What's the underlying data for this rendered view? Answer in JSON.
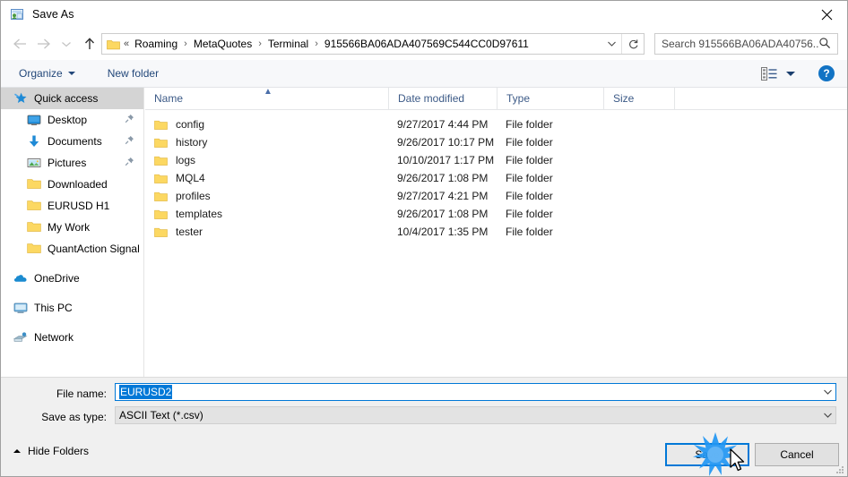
{
  "window": {
    "title": "Save As",
    "icon": "save-as-icon",
    "close_label": "✕"
  },
  "nav": {
    "back_icon": "arrow-left-icon",
    "forward_icon": "arrow-right-icon",
    "recent_icon": "chevron-down-icon",
    "up_icon": "arrow-up-icon",
    "address": {
      "folder_icon": "folder-icon",
      "prefix": "«",
      "crumbs": [
        "Roaming",
        "MetaQuotes",
        "Terminal",
        "915566BA06ADA407569C544CC0D97611"
      ],
      "separator": "›",
      "dropdown_icon": "chevron-down-icon",
      "refresh_icon": "refresh-icon"
    },
    "search": {
      "placeholder": "Search 915566BA06ADA40756...",
      "icon": "search-icon"
    }
  },
  "toolbar": {
    "organize_label": "Organize",
    "new_folder_label": "New folder",
    "view_icon": "view-layout-icon",
    "help_label": "?"
  },
  "sidebar": {
    "items": [
      {
        "label": "Quick access",
        "icon": "quick-access-star-icon",
        "level": 0,
        "selected": true,
        "pinned": false
      },
      {
        "label": "Desktop",
        "icon": "desktop-icon",
        "level": 1,
        "selected": false,
        "pinned": true
      },
      {
        "label": "Documents",
        "icon": "documents-download-icon",
        "level": 1,
        "selected": false,
        "pinned": true
      },
      {
        "label": "Pictures",
        "icon": "pictures-icon",
        "level": 1,
        "selected": false,
        "pinned": true
      },
      {
        "label": "Downloaded",
        "icon": "folder-icon",
        "level": 1,
        "selected": false,
        "pinned": false
      },
      {
        "label": "EURUSD H1",
        "icon": "folder-icon",
        "level": 1,
        "selected": false,
        "pinned": false
      },
      {
        "label": "My Work",
        "icon": "folder-icon",
        "level": 1,
        "selected": false,
        "pinned": false
      },
      {
        "label": "QuantAction Signal",
        "icon": "folder-icon",
        "level": 1,
        "selected": false,
        "pinned": false
      }
    ],
    "groups": [
      {
        "label": "OneDrive",
        "icon": "onedrive-cloud-icon"
      },
      {
        "label": "This PC",
        "icon": "this-pc-icon"
      },
      {
        "label": "Network",
        "icon": "network-icon"
      }
    ]
  },
  "filelist": {
    "columns": [
      "Name",
      "Date modified",
      "Type",
      "Size"
    ],
    "sort_column": "Name",
    "sort_direction": "ascending",
    "rows": [
      {
        "name": "config",
        "date": "9/27/2017 4:44 PM",
        "type": "File folder",
        "size": ""
      },
      {
        "name": "history",
        "date": "9/26/2017 10:17 PM",
        "type": "File folder",
        "size": ""
      },
      {
        "name": "logs",
        "date": "10/10/2017 1:17 PM",
        "type": "File folder",
        "size": ""
      },
      {
        "name": "MQL4",
        "date": "9/26/2017 1:08 PM",
        "type": "File folder",
        "size": ""
      },
      {
        "name": "profiles",
        "date": "9/27/2017 4:21 PM",
        "type": "File folder",
        "size": ""
      },
      {
        "name": "templates",
        "date": "9/26/2017 1:08 PM",
        "type": "File folder",
        "size": ""
      },
      {
        "name": "tester",
        "date": "10/4/2017 1:35 PM",
        "type": "File folder",
        "size": ""
      }
    ]
  },
  "form": {
    "filename_label": "File name:",
    "filename_value": "EURUSD2",
    "savetype_label": "Save as type:",
    "savetype_value": "ASCII Text (*.csv)"
  },
  "footer": {
    "hide_folders_label": "Hide Folders",
    "save_label": "Save",
    "cancel_label": "Cancel"
  },
  "colors": {
    "accent": "#0078d7",
    "folder_yellow": "#ffd24d",
    "breadcrumb_text": "#000000",
    "toolbar_text": "#23487a",
    "column_header_text": "#3c5a87",
    "selection_blue": "#0078d7",
    "sidebar_selected": "#d4d4d4"
  }
}
